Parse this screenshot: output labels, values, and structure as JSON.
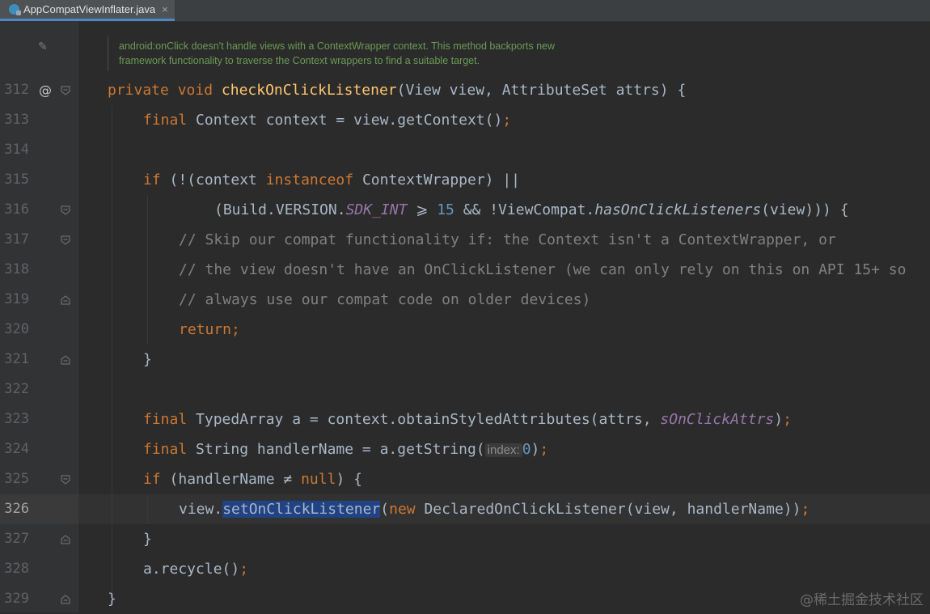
{
  "tab": {
    "filename": "AppCompatViewInflater.java",
    "close": "×"
  },
  "doc_comment": {
    "line1": "android:onClick doesn't handle views with a ContextWrapper context. This method backports new",
    "line2": "framework functionality to traverse the Context wrappers to find a suitable target."
  },
  "lines": [
    {
      "num": "312"
    },
    {
      "num": "313"
    },
    {
      "num": "314"
    },
    {
      "num": "315"
    },
    {
      "num": "316"
    },
    {
      "num": "317"
    },
    {
      "num": "318"
    },
    {
      "num": "319"
    },
    {
      "num": "320"
    },
    {
      "num": "321"
    },
    {
      "num": "322"
    },
    {
      "num": "323"
    },
    {
      "num": "324"
    },
    {
      "num": "325"
    },
    {
      "num": "326"
    },
    {
      "num": "327"
    },
    {
      "num": "328"
    },
    {
      "num": "329"
    }
  ],
  "code": {
    "l312": [
      "private",
      " ",
      "void",
      " ",
      "checkOnClickListener",
      "(View view, AttributeSet attrs) {"
    ],
    "l313": [
      "final",
      " Context context = view.getContext()",
      ";"
    ],
    "l315": [
      "if",
      " (!(context ",
      "instanceof",
      " ContextWrapper) ||"
    ],
    "l316": [
      "(Build.VERSION.",
      "SDK_INT",
      " ⩾ ",
      "15",
      " && !ViewCompat.",
      "hasOnClickListeners",
      "(view))) {"
    ],
    "l317": "// Skip our compat functionality if: the Context isn't a ContextWrapper, or",
    "l318": "// the view doesn't have an OnClickListener (we can only rely on this on API 15+ so",
    "l319": "// always use our compat code on older devices)",
    "l320": [
      "return",
      ";"
    ],
    "l321": "}",
    "l323": [
      "final",
      " TypedArray a = context.obtainStyledAttributes(attrs, ",
      "sOnClickAttrs",
      ")",
      ";"
    ],
    "l324": [
      "final",
      " String handlerName = a.getString(",
      "index:",
      "0",
      ")",
      ";"
    ],
    "l325": [
      "if",
      " (handlerName ≠ ",
      "null",
      ") {"
    ],
    "l326": [
      "view.",
      "setOnClickListener",
      "(",
      "new",
      " DeclaredOnClickListener(view, handlerName))",
      ";"
    ],
    "l327": "}",
    "l328": [
      "a.recycle()",
      ";"
    ],
    "l329": "}"
  },
  "gutter": {
    "at_symbol": "@"
  },
  "watermark": "@稀土掘金技术社区",
  "colors": {
    "keyword": "#cc7832",
    "function": "#ffc66d",
    "static_field": "#9876aa",
    "number": "#6897bb",
    "comment": "#808080",
    "selection": "#214283",
    "doc": "#6a9a55"
  }
}
